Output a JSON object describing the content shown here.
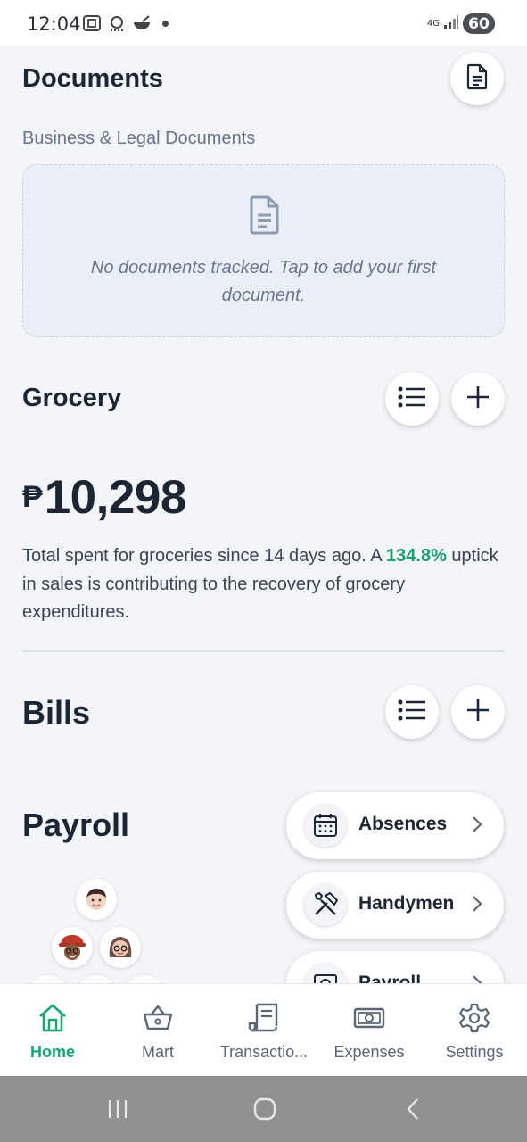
{
  "status_bar": {
    "time": "12:04",
    "network": "4G",
    "battery": "60"
  },
  "documents": {
    "title": "Documents",
    "subtitle": "Business & Legal Documents",
    "empty_text": "No documents tracked. Tap to add your first document.",
    "header_icon": "document-icon"
  },
  "grocery": {
    "title": "Grocery",
    "currency": "₱",
    "amount": "10,298",
    "desc_before": "Total spent for groceries since 14 days ago. A ",
    "percent": "134.8%",
    "desc_after": " uptick in sales is contributing to the recovery of grocery expenditures."
  },
  "bills": {
    "title": "Bills"
  },
  "payroll": {
    "title": "Payroll",
    "avatars": [
      "avatar-man-icon",
      "avatar-woman-hat-icon",
      "avatar-woman-glasses-icon"
    ],
    "actions": [
      {
        "label": "Absences",
        "icon": "calendar-icon"
      },
      {
        "label": "Handymen",
        "icon": "tools-icon"
      },
      {
        "label": "Payroll",
        "icon": "payroll-icon"
      }
    ]
  },
  "bottom_nav": {
    "items": [
      {
        "label": "Home",
        "icon": "home-icon",
        "active": true
      },
      {
        "label": "Mart",
        "icon": "basket-icon",
        "active": false
      },
      {
        "label": "Transactio...",
        "icon": "receipt-icon",
        "active": false
      },
      {
        "label": "Expenses",
        "icon": "cash-icon",
        "active": false
      },
      {
        "label": "Settings",
        "icon": "gear-icon",
        "active": false
      }
    ]
  },
  "colors": {
    "accent_green": "#17a673",
    "text_dark": "#1c2534",
    "background": "#f3f5f8"
  }
}
